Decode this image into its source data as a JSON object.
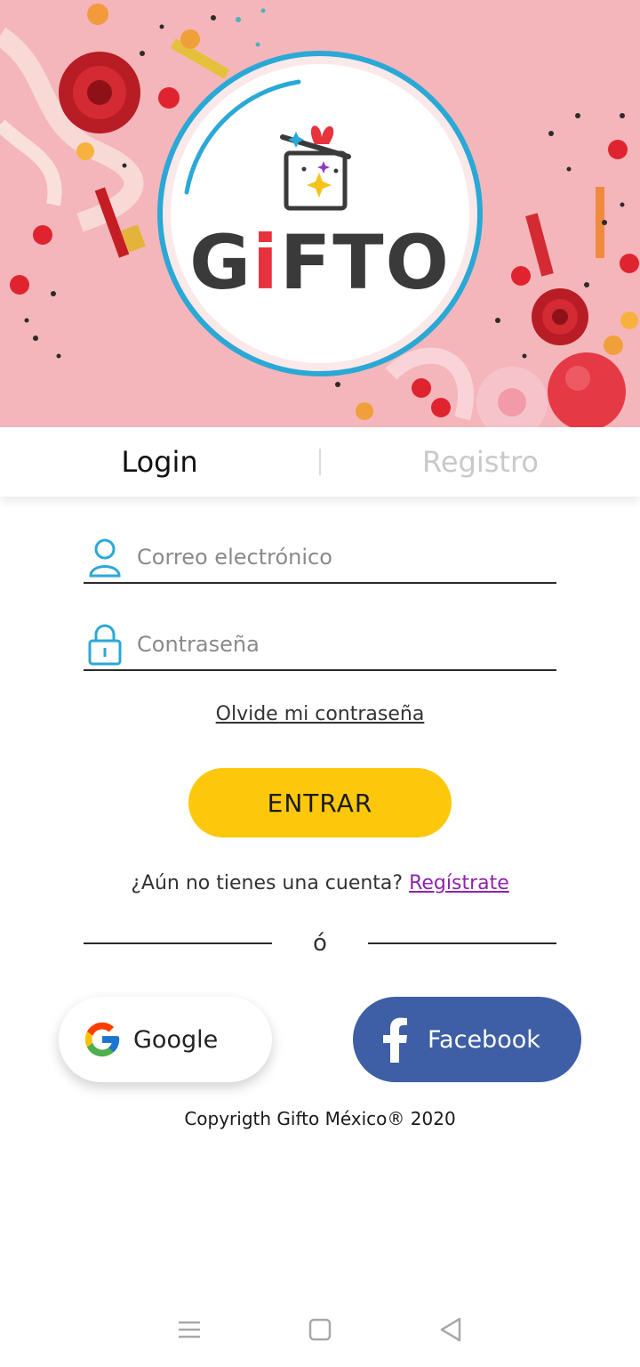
{
  "brand": {
    "name_prefix": "G",
    "name_i": "i",
    "name_suffix": "FTO"
  },
  "tabs": [
    {
      "label": "Login",
      "active": true
    },
    {
      "label": "Registro",
      "active": false
    }
  ],
  "form": {
    "email": {
      "placeholder": "Correo electrónico",
      "value": "",
      "icon": "user-icon"
    },
    "password": {
      "placeholder": "Contraseña",
      "value": "",
      "icon": "lock-icon"
    },
    "forgot_label": "Olvide mi contraseña",
    "submit_label": "ENTRAR",
    "signup_prompt": "¿Aún no tienes una cuenta?",
    "signup_link": "Regístrate",
    "or_label": "ó"
  },
  "social": {
    "google_label": "Google",
    "facebook_label": "Facebook"
  },
  "footer": {
    "copyright": "Copyrigth Gifto México® 2020"
  },
  "colors": {
    "accent_yellow": "#fdc80c",
    "facebook_blue": "#3e5fa6",
    "logo_ring": "#2aa8d6",
    "link_purple": "#8e24aa",
    "hero_pink": "#f4b3b7"
  },
  "system_nav": [
    "menu-icon",
    "home-icon",
    "back-icon"
  ]
}
